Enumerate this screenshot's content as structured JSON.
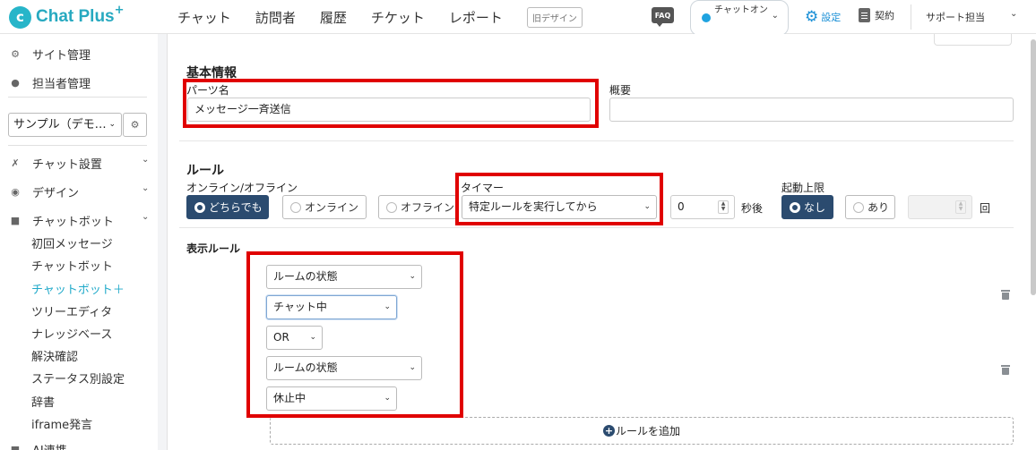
{
  "header": {
    "logo_text": "Chat Plus",
    "logo_plus": "+",
    "nav": [
      "チャット",
      "訪問者",
      "履歴",
      "チケット",
      "レポート"
    ],
    "old_design_label": "旧デザイン",
    "faq_label": "FAQ",
    "chat_status": "チャットオン",
    "settings_label": "設定",
    "contract_label": "契約",
    "support_label": "サポート担当"
  },
  "sidebar": {
    "site_management": "サイト管理",
    "staff_management": "担当者管理",
    "site_select": "サンプル（デモ…",
    "chat_settings": "チャット設置",
    "design": "デザイン",
    "chatbot": "チャットボット",
    "sub_items": [
      "初回メッセージ",
      "チャットボット",
      "チャットボット＋",
      "ツリーエディタ",
      "ナレッジベース",
      "解決確認",
      "ステータス別設定",
      "辞書",
      "iframe発言"
    ],
    "active_sub": "チャットボット＋",
    "cut_item": "AI連携"
  },
  "main": {
    "basic_info_heading": "基本情報",
    "parts_name_label": "パーツ名",
    "parts_name_value": "メッセージ一斉送信",
    "overview_label": "概要",
    "overview_value": "",
    "rule_heading": "ルール",
    "online_offline_label": "オンライン/オフライン",
    "online_options": [
      "どちらでも",
      "オンライン",
      "オフライン"
    ],
    "online_selected": "どちらでも",
    "timer_label": "タイマー",
    "timer_select": "特定ルールを実行してから",
    "timer_seconds": "0",
    "seconds_suffix": "秒後",
    "limit_label": "起動上限",
    "limit_options": [
      "なし",
      "あり"
    ],
    "limit_selected": "なし",
    "limit_count_suffix": "回",
    "display_rule_heading": "表示ルール",
    "rule_group_1": {
      "condition": "ルームの状態",
      "value": "チャット中"
    },
    "operator": "OR",
    "rule_group_2": {
      "condition": "ルームの状態",
      "value": "休止中"
    },
    "add_rule_label": "ルールを追加"
  },
  "colors": {
    "brand": "#27a9c0",
    "selected": "#2b4b6f",
    "highlight": "#e00000",
    "settings": "#1a8fd6"
  }
}
